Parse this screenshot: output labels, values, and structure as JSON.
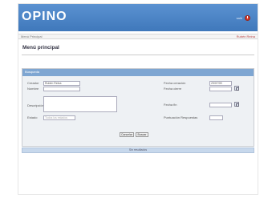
{
  "app": {
    "brand": "OPINO",
    "user_label": "salir"
  },
  "breadcrumb": {
    "current": "Menú Principal",
    "right_link": "Rubén Reina"
  },
  "page": {
    "title": "Menú principal"
  },
  "panel": {
    "header": "Búsqueda",
    "fields": {
      "creador_label": "Creador",
      "creador_value": "Rubén Reina",
      "nombre_label": "Nombre",
      "nombre_value": "",
      "descripcion_label": "Descripción",
      "estado_label": "Estado",
      "estado_value": "Todos los estados",
      "fecha_creacion_label": "Fecha creación",
      "fecha_creacion_value": "29/07/09",
      "fecha_cierre_label": "Fecha cierre",
      "fecha_fin_label": "Fecha fin",
      "puntuacion_label": "Puntuación Respuestas"
    },
    "buttons": {
      "cancel": "Cancelar",
      "search": "Buscar"
    }
  },
  "footer": {
    "text": "Sin resultados"
  }
}
